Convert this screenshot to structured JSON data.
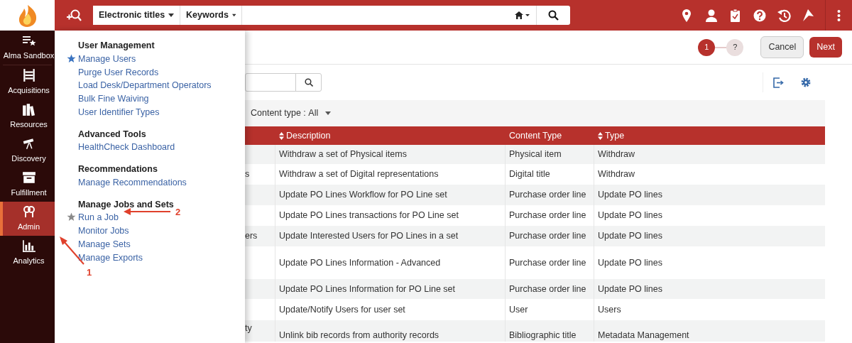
{
  "header": {
    "search_scope": "Electronic titles",
    "search_field": "Keywords"
  },
  "sidebar": {
    "items": [
      {
        "label": "Alma Sandbox",
        "selected": false
      },
      {
        "label": "Acquisitions",
        "selected": false
      },
      {
        "label": "Resources",
        "selected": false
      },
      {
        "label": "Discovery",
        "selected": false
      },
      {
        "label": "Fulfillment",
        "selected": false
      },
      {
        "label": "Admin",
        "selected": true
      },
      {
        "label": "Analytics",
        "selected": false
      }
    ]
  },
  "menu": {
    "sections": [
      {
        "heading": "User Management",
        "items": [
          {
            "label": "Manage Users",
            "starred": true
          },
          {
            "label": "Purge User Records"
          },
          {
            "label": "Load Desk/Department Operators"
          },
          {
            "label": "Bulk Fine Waiving"
          },
          {
            "label": "User Identifier Types"
          }
        ]
      },
      {
        "heading": "Advanced Tools",
        "items": [
          {
            "label": "HealthCheck Dashboard"
          }
        ]
      },
      {
        "heading": "Recommendations",
        "items": [
          {
            "label": "Manage Recommendations"
          }
        ]
      },
      {
        "heading": "Manage Jobs and Sets",
        "items": [
          {
            "label": "Run a Job",
            "starred": false
          },
          {
            "label": "Monitor Jobs"
          },
          {
            "label": "Manage Sets"
          },
          {
            "label": "Manage Exports"
          }
        ]
      }
    ]
  },
  "stepper": {
    "steps": [
      {
        "label": "1",
        "selected": true
      },
      {
        "label": "?",
        "selected": false
      }
    ]
  },
  "buttons": {
    "cancel": "Cancel",
    "next": "Next"
  },
  "filter": {
    "label": "Content type :",
    "value": "All"
  },
  "table": {
    "columns": [
      {
        "label": "Description",
        "sortable": true
      },
      {
        "label": "Content Type",
        "sortable": false
      },
      {
        "label": "Type",
        "sortable": true
      }
    ],
    "rows": [
      {
        "column_1": "",
        "description": "Withdraw a set of Physical items",
        "content_type": "Physical item",
        "type": "Withdraw"
      },
      {
        "column_1": "s",
        "description": "Withdraw a set of Digital representations",
        "content_type": "Digital title",
        "type": "Withdraw"
      },
      {
        "column_1": "",
        "description": "Update PO Lines Workflow for PO Line set",
        "content_type": "Purchase order line",
        "type": "Update PO lines"
      },
      {
        "column_1": "",
        "description": "Update PO Lines transactions for PO Line set",
        "content_type": "Purchase order line",
        "type": "Update PO lines"
      },
      {
        "column_1": "ers",
        "description": "Update Interested Users for PO Lines in a set",
        "content_type": "Purchase order line",
        "type": "Update PO lines"
      },
      {
        "column_1": "",
        "description": "Update PO Lines Information - Advanced",
        "content_type": "Purchase order line",
        "type": "Update PO lines"
      },
      {
        "column_1": "",
        "description": "Update PO Lines Information for PO Line set",
        "content_type": "Purchase order line",
        "type": "Update PO lines"
      },
      {
        "column_1": "",
        "description": "Update/Notify Users for user set",
        "content_type": "User",
        "type": "Users"
      },
      {
        "column_1": "ty",
        "description": "Unlink bib records from authority records",
        "content_type": "Bibliographic title",
        "type": "Metadata Management"
      }
    ]
  },
  "annotations": [
    {
      "label": "1"
    },
    {
      "label": "2"
    }
  ]
}
